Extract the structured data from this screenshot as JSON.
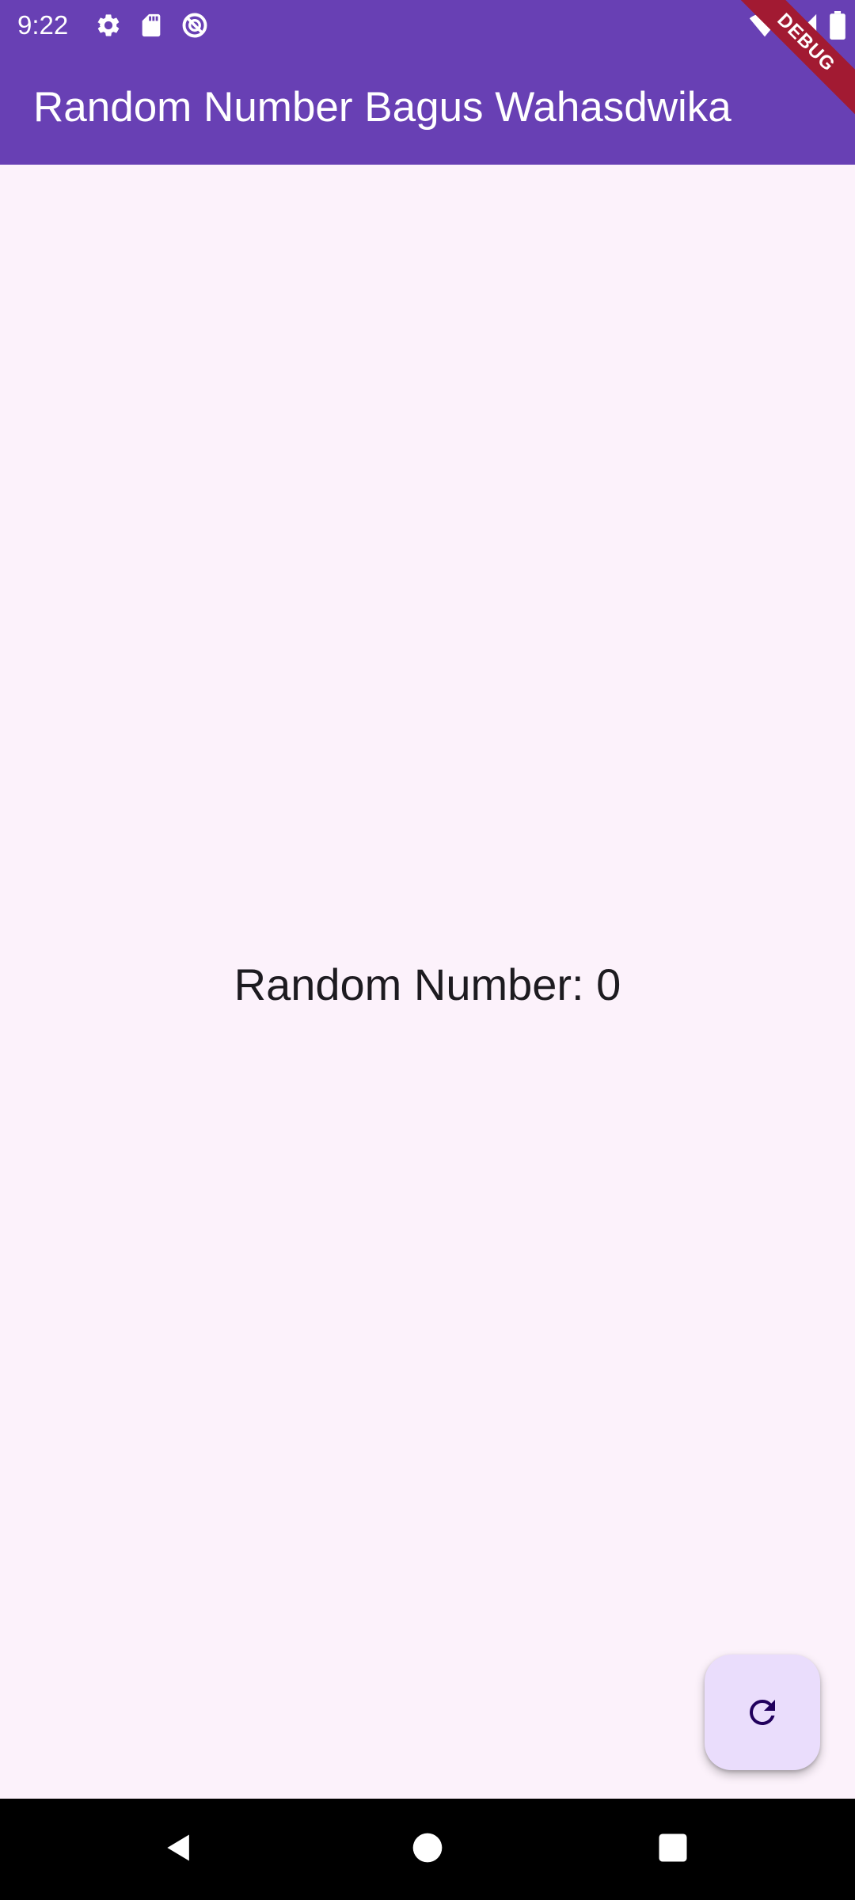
{
  "status_bar": {
    "time": "9:22",
    "left_icons": [
      "settings-icon",
      "sd-card-icon",
      "do-not-disturb-icon"
    ],
    "right_icons": [
      "wifi-icon",
      "cell-signal-icon",
      "battery-icon"
    ]
  },
  "app_bar": {
    "title": "Random Number Bagus Wahasdwika",
    "background_color": "#6840B4"
  },
  "debug_banner": {
    "label": "DEBUG"
  },
  "main": {
    "random_number_text": "Random Number: 0",
    "background_color": "#FCF2FB"
  },
  "fab": {
    "icon": "refresh-icon",
    "background_color": "#EADDFC"
  },
  "nav_bar": {
    "buttons": [
      "back-icon",
      "home-icon",
      "recents-icon"
    ]
  }
}
